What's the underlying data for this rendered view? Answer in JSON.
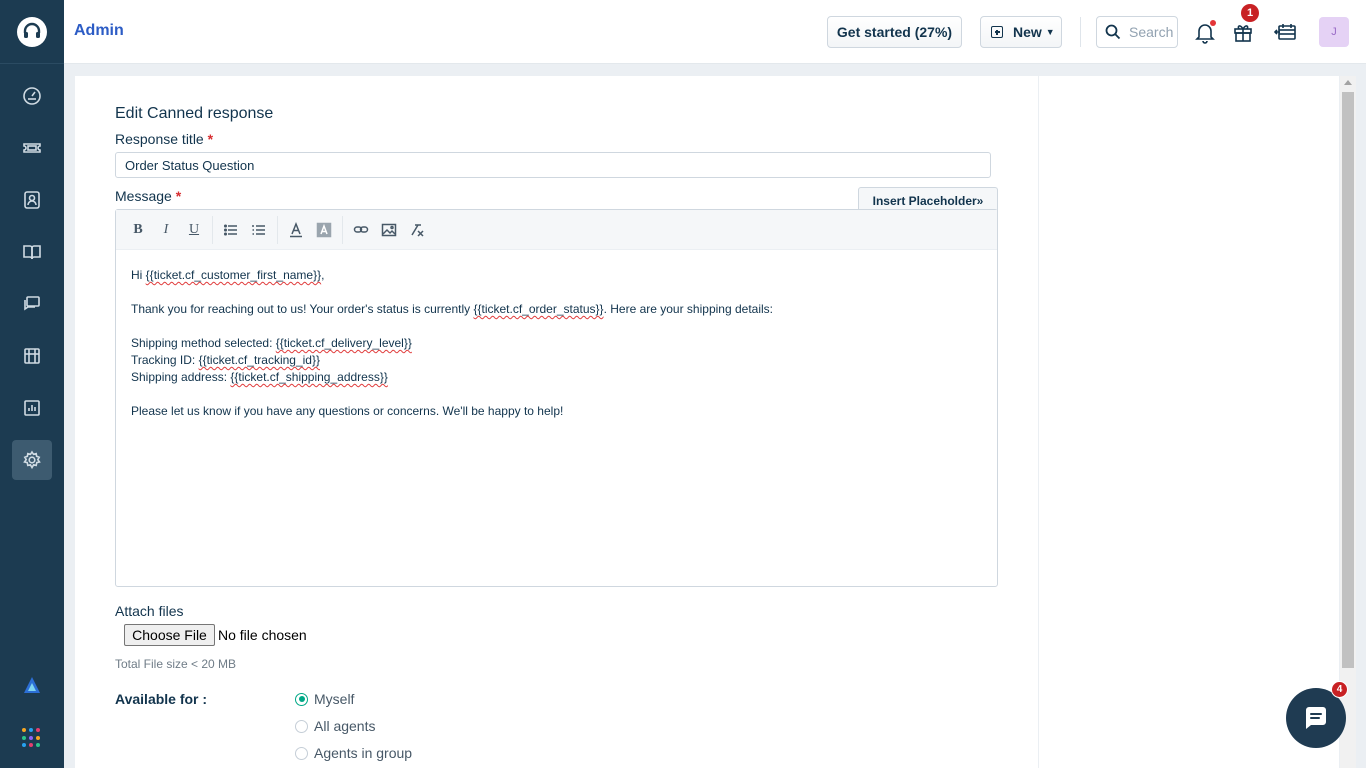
{
  "header": {
    "title": "Admin",
    "get_started_label": "Get started (27%)",
    "new_label": "New",
    "search_placeholder": "Search",
    "gift_badge": "1",
    "avatar_initial": "J"
  },
  "sidebar": {
    "items": [
      {
        "icon": "dashboard-icon"
      },
      {
        "icon": "tickets-icon"
      },
      {
        "icon": "contacts-icon"
      },
      {
        "icon": "solutions-icon"
      },
      {
        "icon": "forums-icon"
      },
      {
        "icon": "social-icon"
      },
      {
        "icon": "reports-icon"
      },
      {
        "icon": "admin-gear-icon",
        "active": true
      }
    ]
  },
  "form": {
    "heading": "Edit Canned response",
    "title_label": "Response title",
    "title_value": "Order Status Question",
    "message_label": "Message",
    "insert_placeholder_label": "Insert Placeholder»",
    "required_mark": "*",
    "toolbar": [
      "bold",
      "italic",
      "underline",
      "bulleted-list",
      "numbered-list",
      "font-color",
      "background-color",
      "link",
      "image",
      "clear-format"
    ],
    "message": {
      "greeting_prefix": "Hi ",
      "greeting_placeholder": "{{ticket.cf_customer_first_name}}",
      "greeting_suffix": ",",
      "line2_prefix": "Thank you for reaching out to us! Your order's status is currently ",
      "line2_placeholder": "{{ticket.cf_order_status}}",
      "line2_suffix": ". Here are your shipping details:",
      "shipping_method_prefix": "Shipping method selected: ",
      "shipping_method_placeholder": "{{ticket.cf_delivery_level}}",
      "tracking_prefix": "Tracking ID: ",
      "tracking_placeholder": "{{ticket.cf_tracking_id}}",
      "address_prefix": "Shipping address: ",
      "address_placeholder": "{{ticket.cf_shipping_address}}",
      "closing": "Please let us know if you have any questions or concerns. We'll be happy to help!"
    },
    "attach_label": "Attach files",
    "choose_file_label": "Choose File",
    "file_status": "No file chosen",
    "file_hint": "Total File size < 20 MB",
    "available_label": "Available for :",
    "availability_options": [
      {
        "label": "Myself",
        "selected": true
      },
      {
        "label": "All agents",
        "selected": false
      },
      {
        "label": "Agents in group",
        "selected": false
      }
    ]
  },
  "chat": {
    "badge": "4"
  },
  "colors": {
    "sidebar_bg": "#1c3b51",
    "accent_blue": "#2c5cc5",
    "radio_selected": "#00a886",
    "badge_red": "#c82124"
  }
}
